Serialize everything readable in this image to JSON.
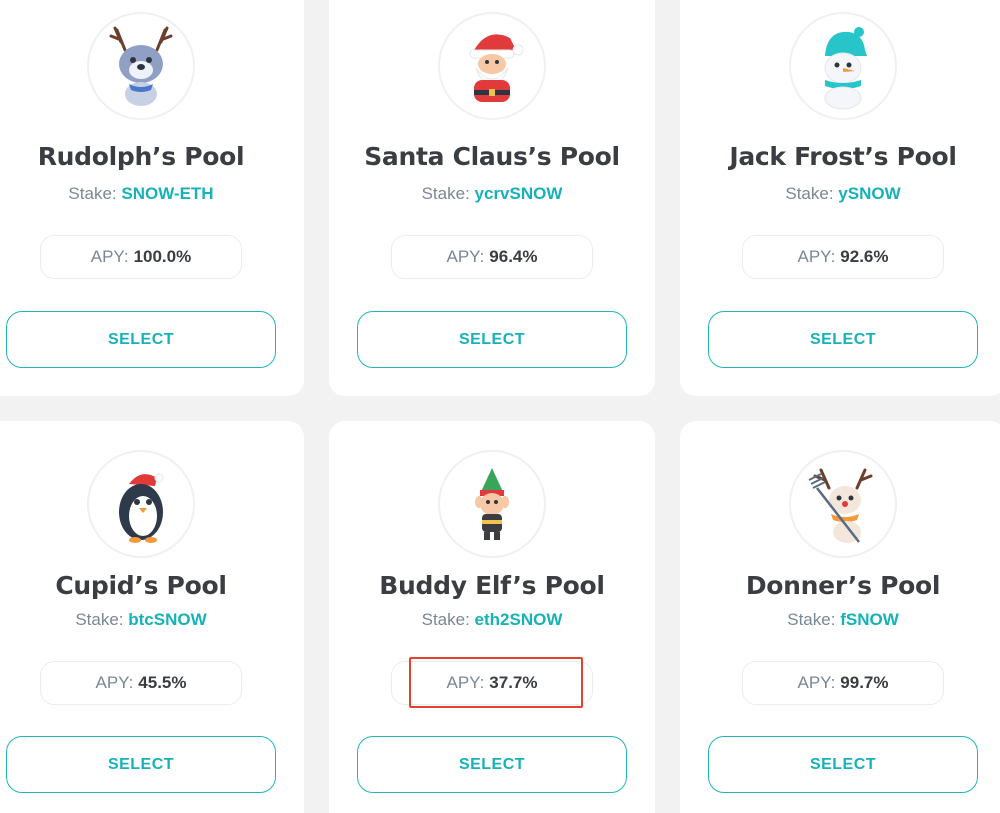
{
  "stake_prefix": "Stake:",
  "apy_prefix": "APY:",
  "select_label": "SELECT",
  "colors": {
    "accent": "#17b2b8",
    "highlight": "#e0442e"
  },
  "pools": [
    {
      "name": "Rudolph’s Pool",
      "token": "SNOW-ETH",
      "apy": "100.0%",
      "icon": "reindeer-icon"
    },
    {
      "name": "Santa Claus’s Pool",
      "token": "ycrvSNOW",
      "apy": "96.4%",
      "icon": "santa-icon"
    },
    {
      "name": "Jack Frost’s Pool",
      "token": "ySNOW",
      "apy": "92.6%",
      "icon": "snowman-icon"
    },
    {
      "name": "Cupid’s Pool",
      "token": "btcSNOW",
      "apy": "45.5%",
      "icon": "penguin-icon"
    },
    {
      "name": "Buddy Elf’s Pool",
      "token": "eth2SNOW",
      "apy": "37.7%",
      "icon": "elf-icon"
    },
    {
      "name": "Donner’s Pool",
      "token": "fSNOW",
      "apy": "99.7%",
      "icon": "donner-reindeer-icon"
    }
  ]
}
